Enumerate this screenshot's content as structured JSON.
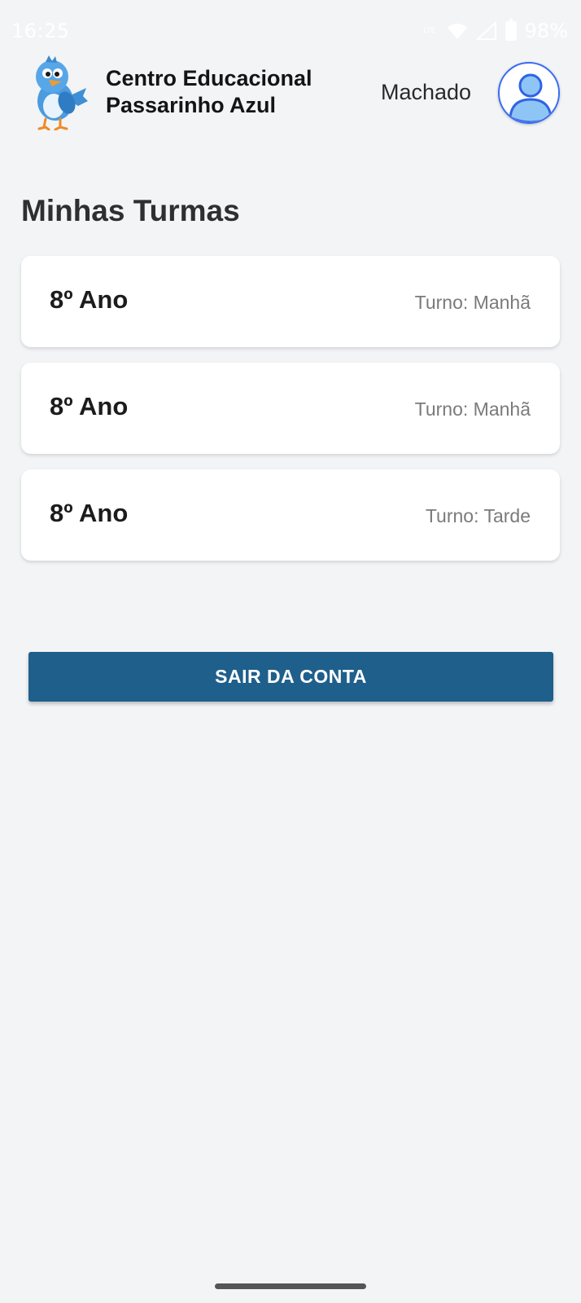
{
  "status_bar": {
    "time": "16:25",
    "network": "LTE",
    "battery": "98%"
  },
  "header": {
    "school_name_line1": "Centro Educacional",
    "school_name_line2": "Passarinho Azul",
    "user_name": "Machado",
    "logo_icon": "blue-bird-mascot",
    "avatar_icon": "user-icon"
  },
  "main": {
    "title": "Minhas Turmas",
    "classes": [
      {
        "name": "8º Ano",
        "shift": "Turno: Manhã"
      },
      {
        "name": "8º Ano",
        "shift": "Turno: Manhã"
      },
      {
        "name": "8º Ano",
        "shift": "Turno: Tarde"
      }
    ],
    "logout_label": "SAIR DA CONTA"
  },
  "colors": {
    "background": "#f3f4f6",
    "primary": "#1f5f8b",
    "avatar_accent": "#3b6df0"
  }
}
